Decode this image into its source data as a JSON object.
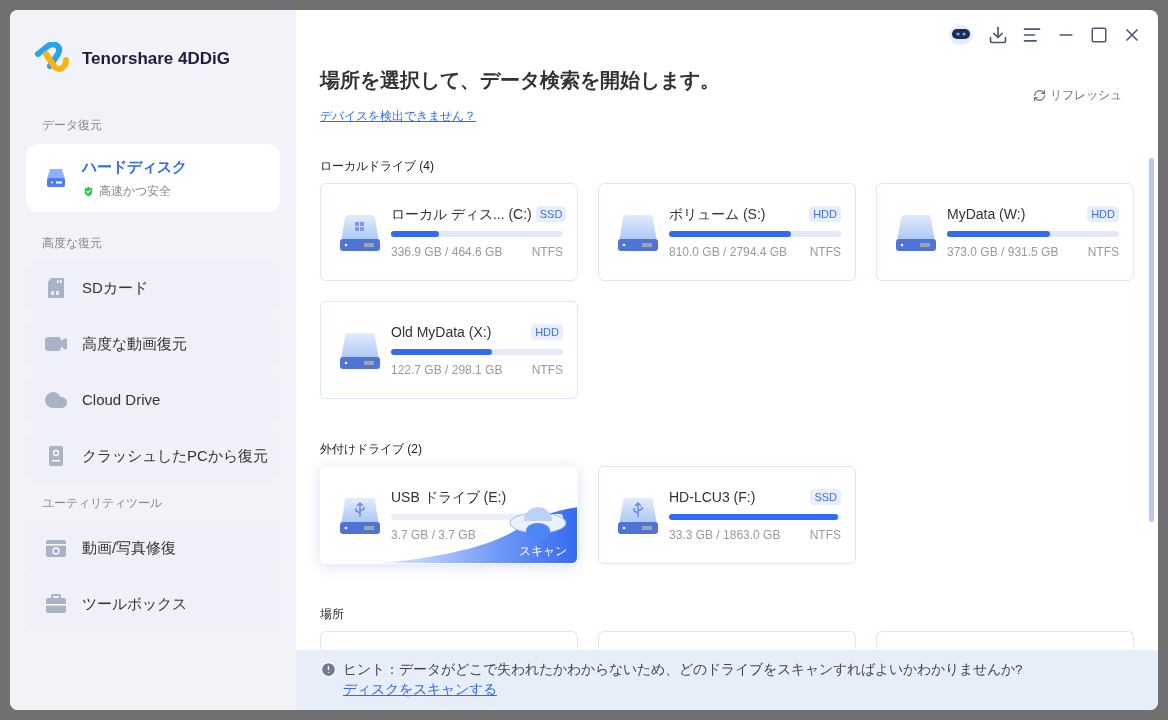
{
  "app": {
    "name": "Tenorshare 4DDiG"
  },
  "sidebar": {
    "sections": [
      {
        "label": "データ復元",
        "items": [
          {
            "label": "ハードディスク",
            "kind": "harddisk",
            "selected": true,
            "subtitle": "高速かつ安全"
          }
        ]
      },
      {
        "label": "高度な復元",
        "items": [
          {
            "label": "SDカード",
            "kind": "sdcard",
            "selected": false
          },
          {
            "label": "高度な動画復元",
            "kind": "video",
            "selected": false
          },
          {
            "label": "Cloud Drive",
            "kind": "cloud",
            "selected": false
          },
          {
            "label": "クラッシュしたPCから復元",
            "kind": "pc",
            "selected": false
          }
        ]
      },
      {
        "label": "ユーティリティツール",
        "items": [
          {
            "label": "動画/写真修復",
            "kind": "repair",
            "selected": false
          },
          {
            "label": "ツールボックス",
            "kind": "toolbox",
            "selected": false
          }
        ]
      }
    ]
  },
  "main": {
    "title": "場所を選択して、データ検索を開始します。",
    "help_link": "デバイスを検出できません？",
    "refresh": "リフレッシュ",
    "groups": [
      {
        "label": "ローカルドライブ (4)",
        "drives": [
          {
            "name": "ローカル ディス... (C:)",
            "kind": "system",
            "type": "SSD",
            "usage": "336.9 GB / 464.6 GB",
            "fs": "NTFS",
            "level": 0.28,
            "hovered": false
          },
          {
            "name": "ボリューム (S:)",
            "kind": "disk",
            "type": "HDD",
            "usage": "810.0 GB / 2794.4 GB",
            "fs": "NTFS",
            "level": 0.71,
            "hovered": false
          },
          {
            "name": "MyData (W:)",
            "kind": "disk",
            "type": "HDD",
            "usage": "373.0 GB / 931.5 GB",
            "fs": "NTFS",
            "level": 0.6,
            "hovered": false
          },
          {
            "name": "Old MyData (X:)",
            "kind": "disk",
            "type": "HDD",
            "usage": "122.7 GB / 298.1 GB",
            "fs": "NTFS",
            "level": 0.59,
            "hovered": false
          }
        ]
      },
      {
        "label": "外付けドライブ (2)",
        "drives": [
          {
            "name": "USB ドライブ (E:)",
            "kind": "usb",
            "usage": "3.7 GB / 3.7 GB",
            "hovered": true,
            "scan_label": "スキャン"
          },
          {
            "name": "HD-LCU3 (F:)",
            "kind": "usb",
            "type": "SSD",
            "usage": "33.3 GB / 1863.0 GB",
            "fs": "NTFS",
            "level": 0.98,
            "hovered": false
          }
        ]
      },
      {
        "label": "場所"
      }
    ]
  },
  "hint": {
    "text": "ヒント：データがどこで失われたかわからないため、どのドライブをスキャンすればよいかわかりませんか?",
    "link": "ディスクをスキャンする"
  }
}
